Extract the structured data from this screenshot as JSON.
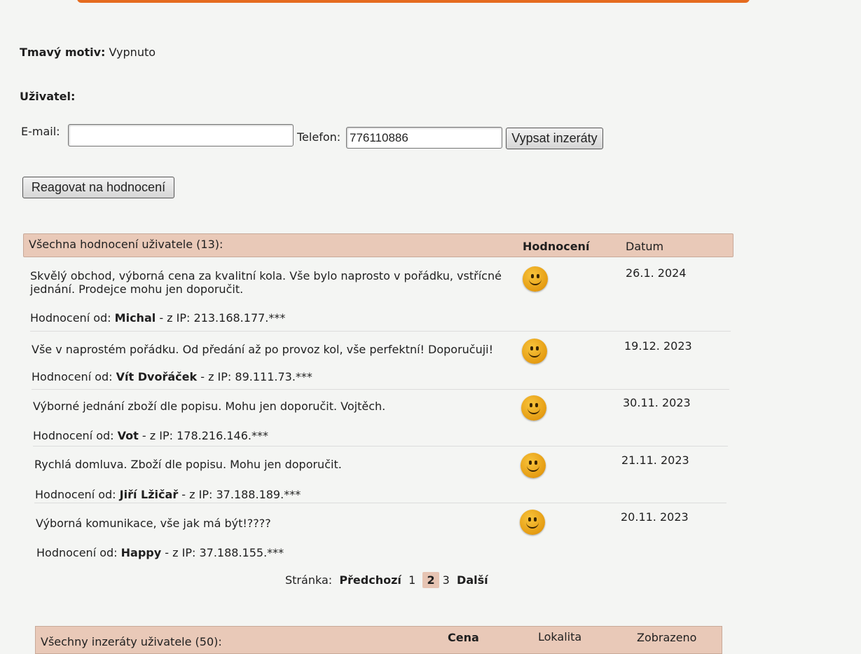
{
  "settings": {
    "dark_mode_label": "Tmavý motiv:",
    "dark_mode_value": "Vypnuto"
  },
  "user": {
    "heading": "Uživatel:",
    "email_label": "E-mail:",
    "email_value": "",
    "phone_label": "Telefon:",
    "phone_value": "776110886",
    "list_button": "Vypsat inzeráty",
    "react_button": "Reagovat na hodnocení"
  },
  "ratings": {
    "header_title": "Všechna hodnocení uživatele (13):",
    "header_rating": "Hodnocení",
    "header_date": "Datum",
    "from_prefix": "Hodnocení od:",
    "ip_prefix": "- z IP:",
    "rating_icon": "smiley-icon",
    "items": [
      {
        "text": "Skvělý obchod, výborná cena za kvalitní kola. Vše bylo naprosto v pořádku, vstřícné",
        "text2": "jednání. Prodejce mohu jen doporučit.",
        "author": "Michal",
        "ip": "213.168.177.***",
        "date": "26.1. 2024"
      },
      {
        "text": "Vše v naprostém pořádku. Od předání až po provoz kol, vše perfektní! Doporučuji!",
        "text2": "",
        "author": "Vít Dvořáček",
        "ip": "89.111.73.***",
        "date": "19.12. 2023"
      },
      {
        "text": "Výborné jednání zboží dle popisu. Mohu jen doporučit. Vojtěch.",
        "text2": "",
        "author": "Vot",
        "ip": "178.216.146.***",
        "date": "30.11. 2023"
      },
      {
        "text": "Rychlá domluva. Zboží dle popisu. Mohu jen doporučit.",
        "text2": "",
        "author": "Jiří Lžičař",
        "ip": "37.188.189.***",
        "date": "21.11. 2023"
      },
      {
        "text": "Výborná komunikace, vše jak má být!????",
        "text2": "",
        "author": "Happy",
        "ip": "37.188.155.***",
        "date": "20.11. 2023"
      }
    ]
  },
  "pagination": {
    "label": "Stránka:",
    "prev": "Předchozí",
    "page1": "1",
    "page2": "2",
    "page3": "3",
    "next": "Další"
  },
  "listings": {
    "header_title": "Všechny inzeráty uživatele (50):",
    "col_price": "Cena",
    "col_location": "Lokalita",
    "col_views": "Zobrazeno"
  }
}
